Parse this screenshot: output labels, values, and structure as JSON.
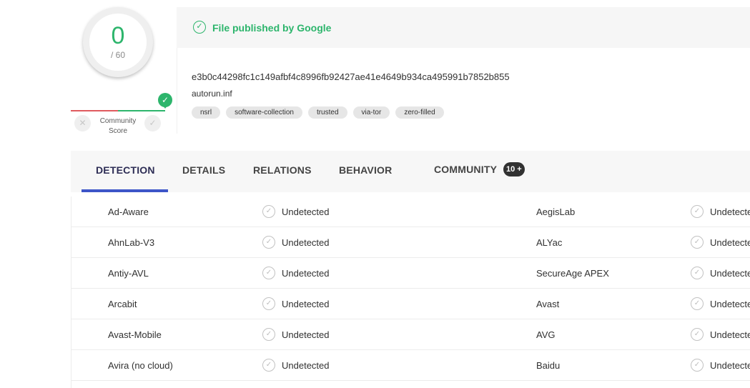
{
  "score": {
    "positives": "0",
    "total": "/ 60"
  },
  "community": {
    "label": "Community Score",
    "check_glyph": "✓",
    "vote_down_glyph": "✕",
    "vote_up_glyph": "✓"
  },
  "file": {
    "publisher": "File published by Google",
    "publisher_icon": "check-circle-icon",
    "hash": "e3b0c44298fc1c149afbf4c8996fb92427ae41e4649b934ca495991b7852b855",
    "name": "autorun.inf",
    "tags": [
      "nsrl",
      "software-collection",
      "trusted",
      "via-tor",
      "zero-filled"
    ]
  },
  "tabs": {
    "detection": "DETECTION",
    "details": "DETAILS",
    "relations": "RELATIONS",
    "behavior": "BEHAVIOR",
    "community": "COMMUNITY",
    "community_badge": "10 +",
    "active": "detection"
  },
  "detections": [
    {
      "left_engine": "Ad-Aware",
      "left_result": "Undetected",
      "right_engine": "AegisLab",
      "right_result": "Undetecte"
    },
    {
      "left_engine": "AhnLab-V3",
      "left_result": "Undetected",
      "right_engine": "ALYac",
      "right_result": "Undetecte"
    },
    {
      "left_engine": "Antiy-AVL",
      "left_result": "Undetected",
      "right_engine": "SecureAge APEX",
      "right_result": "Undetecte"
    },
    {
      "left_engine": "Arcabit",
      "left_result": "Undetected",
      "right_engine": "Avast",
      "right_result": "Undetecte"
    },
    {
      "left_engine": "Avast-Mobile",
      "left_result": "Undetected",
      "right_engine": "AVG",
      "right_result": "Undetecte"
    },
    {
      "left_engine": "Avira (no cloud)",
      "left_result": "Undetected",
      "right_engine": "Baidu",
      "right_result": "Undetecte"
    }
  ],
  "colors": {
    "clean_green": "#2db56c",
    "malicious_red": "#e05a5e",
    "tab_accent": "#3d55c8",
    "text": "#313131"
  },
  "icons": {
    "undetected": "check-circle-icon",
    "undetected_glyph": "✓"
  }
}
